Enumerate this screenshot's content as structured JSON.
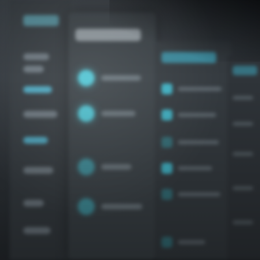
{
  "colors": {
    "accent": "#4fc3d2",
    "panel": "#3b4247",
    "background": "#2b2f33"
  },
  "icons": {
    "row_dot": "circle-icon",
    "row_square": "square-icon"
  }
}
